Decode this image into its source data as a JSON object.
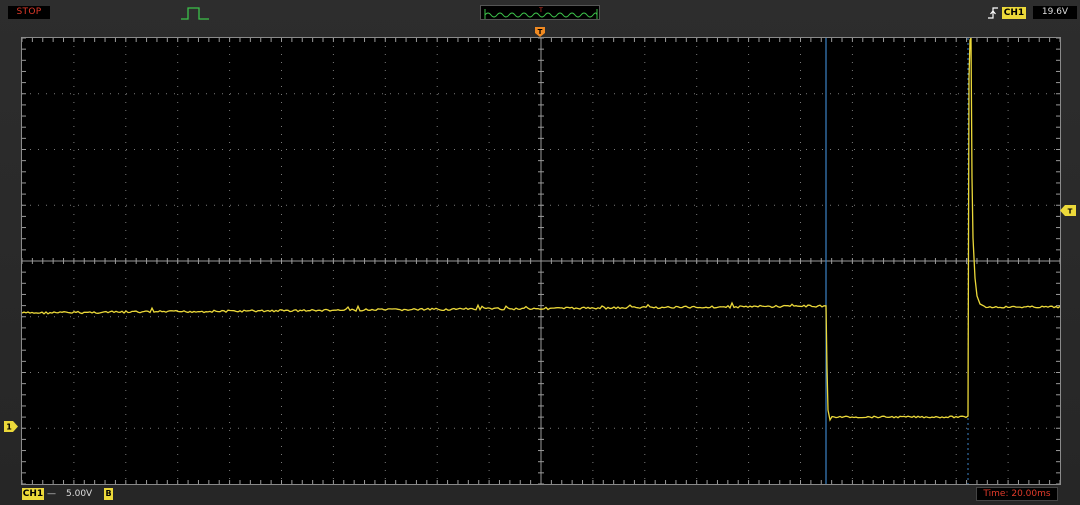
{
  "status": {
    "run_state": "STOP"
  },
  "trigger": {
    "edge": "rising",
    "edge_icon": "rising-edge-icon",
    "source": "CH1",
    "level": "19.6V",
    "position_marker": "T",
    "level_marker": "T"
  },
  "channel1": {
    "marker": "1",
    "label": "CH1",
    "coupling": "DC",
    "coupling_glyph": "—",
    "volts_per_div": "5.00V",
    "bw_limit_badge": "B",
    "color": "#ecd93a"
  },
  "timebase": {
    "label": "Time: 20.00ms"
  },
  "colors": {
    "trace": "#ecd93a",
    "cursor": "#3b82c4",
    "stop_text": "#e03a2a",
    "time_text": "#e03a2a",
    "trigger_marker": "#f08a22",
    "grid": "#7a7a7a"
  },
  "icons": {
    "trigger_mode": "pulse-icon",
    "memory_map": "waveform-overview-icon"
  },
  "grid": {
    "h_divisions": 20,
    "v_divisions": 8
  }
}
